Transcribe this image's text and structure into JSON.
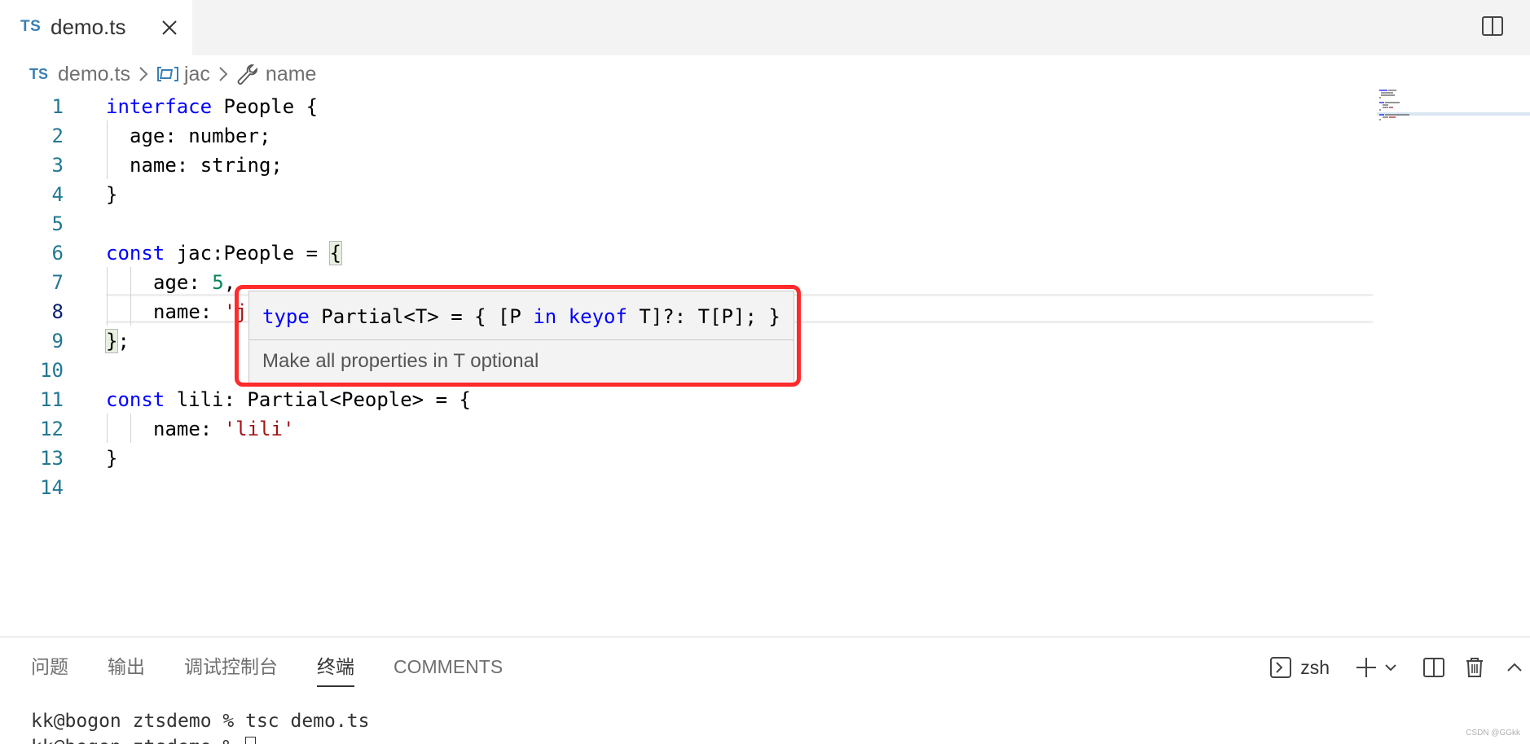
{
  "tab": {
    "badge": "TS",
    "filename": "demo.ts"
  },
  "breadcrumb": {
    "badge": "TS",
    "file": "demo.ts",
    "symbol": "jac",
    "property": "name"
  },
  "line_numbers": [
    "1",
    "2",
    "3",
    "4",
    "5",
    "6",
    "7",
    "8",
    "9",
    "10",
    "11",
    "12",
    "13",
    "14"
  ],
  "code": {
    "l1_kw": "interface",
    "l1_rest": " People {",
    "l2": "age: number;",
    "l3": "name: string;",
    "l4": "}",
    "l6_kw": "const",
    "l6_rest": " jac:People = ",
    "l6_brace": "{",
    "l7_key": "age: ",
    "l7_num": "5",
    "l7_comma": ",",
    "l8_key": "name: ",
    "l8_str": "'j",
    "l9_brace": "}",
    "l9_semi": ";",
    "l11_kw": "const",
    "l11_rest": " lili: Partial<People> = {",
    "l12_key": "name: ",
    "l12_str": "'lili'",
    "l13": "}"
  },
  "hover": {
    "kw_type": "type",
    "sig_1": " Partial<T> = { [P ",
    "kw_in": "in",
    "sp": " ",
    "kw_keyof": "keyof",
    "sig_2": " T]?: T[P]; }",
    "doc": "Make all properties in T optional"
  },
  "panel": {
    "tabs": [
      "问题",
      "输出",
      "调试控制台",
      "终端",
      "COMMENTS"
    ],
    "active_tab": "终端",
    "terminal_name": "zsh"
  },
  "terminal": {
    "line1": "kk@bogon ztsdemo % tsc demo.ts",
    "line2": "kk@bogon ztsdemo % "
  },
  "watermark": "CSDN @GGkk",
  "colors": {
    "keyword": "#0000ff",
    "string": "#a31515",
    "number": "#098658",
    "line_number": "#237893",
    "highlight_box": "#ff2a2a"
  }
}
